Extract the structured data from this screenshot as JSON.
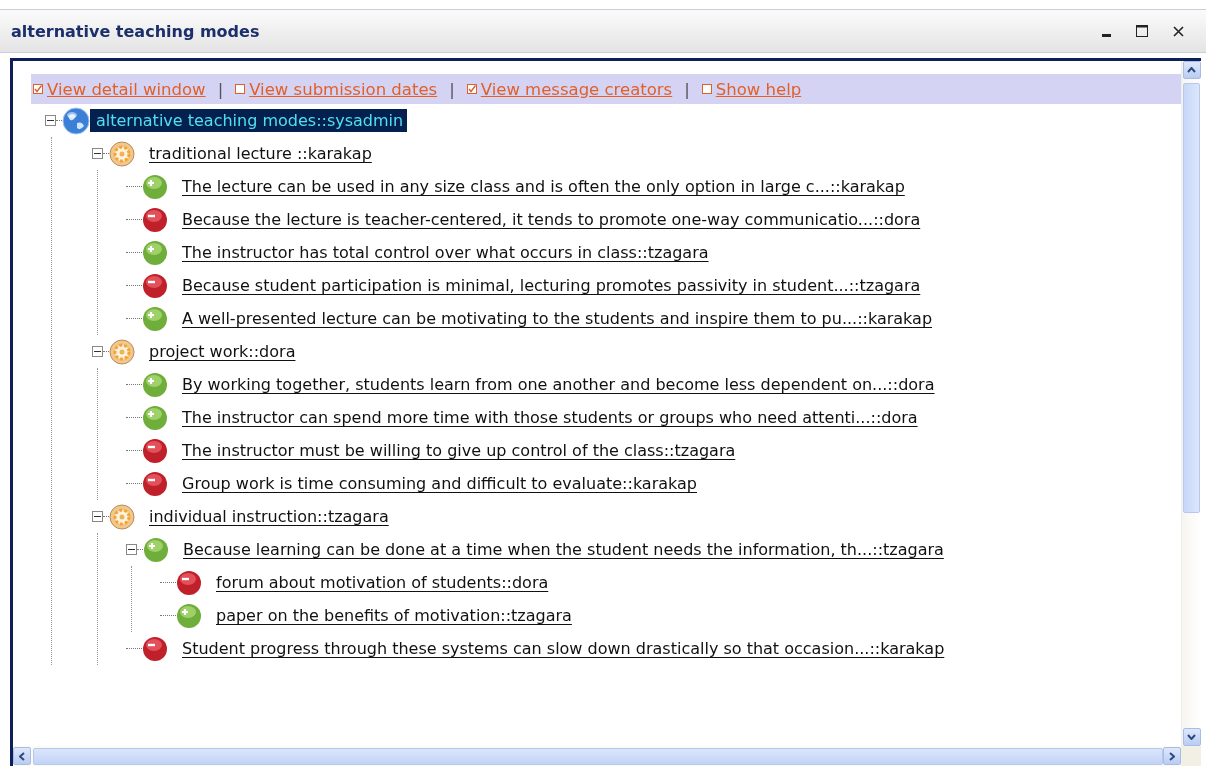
{
  "window": {
    "title": "alternative teaching modes"
  },
  "options_bar": {
    "separator": "|",
    "options": [
      {
        "label": "View detail window",
        "checked": true
      },
      {
        "label": "View submission dates",
        "checked": false
      },
      {
        "label": "View message creators",
        "checked": true
      },
      {
        "label": "Show help",
        "checked": false
      }
    ]
  },
  "tree": [
    {
      "kind": "root",
      "label": "alternative teaching modes::sysadmin",
      "selected": true,
      "expanded": true,
      "children": [
        {
          "kind": "issue",
          "label": "traditional lecture ::karakap",
          "selected": false,
          "expanded": true,
          "children": [
            {
              "kind": "pro",
              "label": "The lecture can be used in any size class and is often the only option in large c...::karakap",
              "selected": false
            },
            {
              "kind": "con",
              "label": "Because the lecture is teacher-centered, it tends to promote one-way communicatio...::dora",
              "selected": false
            },
            {
              "kind": "pro",
              "label": "The instructor has total control over what occurs in class::tzagara",
              "selected": false
            },
            {
              "kind": "con",
              "label": "Because student participation is minimal, lecturing promotes passivity in student...::tzagara",
              "selected": false
            },
            {
              "kind": "pro",
              "label": "A well-presented lecture can be motivating to the students and inspire them to pu...::karakap",
              "selected": false
            }
          ]
        },
        {
          "kind": "issue",
          "label": "project work::dora",
          "selected": false,
          "expanded": true,
          "children": [
            {
              "kind": "pro",
              "label": "By working together, students learn from one another and become less dependent on...::dora",
              "selected": false
            },
            {
              "kind": "pro",
              "label": "The instructor can spend more time with those students or groups who need attenti...::dora",
              "selected": false
            },
            {
              "kind": "con",
              "label": "The instructor must be willing to give up control of the class::tzagara",
              "selected": false
            },
            {
              "kind": "con",
              "label": "Group work is time consuming and difficult to evaluate::karakap",
              "selected": false
            }
          ]
        },
        {
          "kind": "issue",
          "label": "individual instruction::tzagara",
          "selected": false,
          "expanded": true,
          "children": [
            {
              "kind": "pro",
              "label": "Because learning can be done at a time when the student needs the information, th...::tzagara",
              "selected": false,
              "expanded": true,
              "children": [
                {
                  "kind": "con",
                  "label": "forum about motivation of students::dora",
                  "selected": false
                },
                {
                  "kind": "pro",
                  "label": "paper on the benefits of motivation::tzagara",
                  "selected": false
                }
              ]
            },
            {
              "kind": "con",
              "label": "Student progress through these systems can slow down drastically so that occasion...::karakap",
              "selected": false
            }
          ]
        }
      ]
    }
  ]
}
